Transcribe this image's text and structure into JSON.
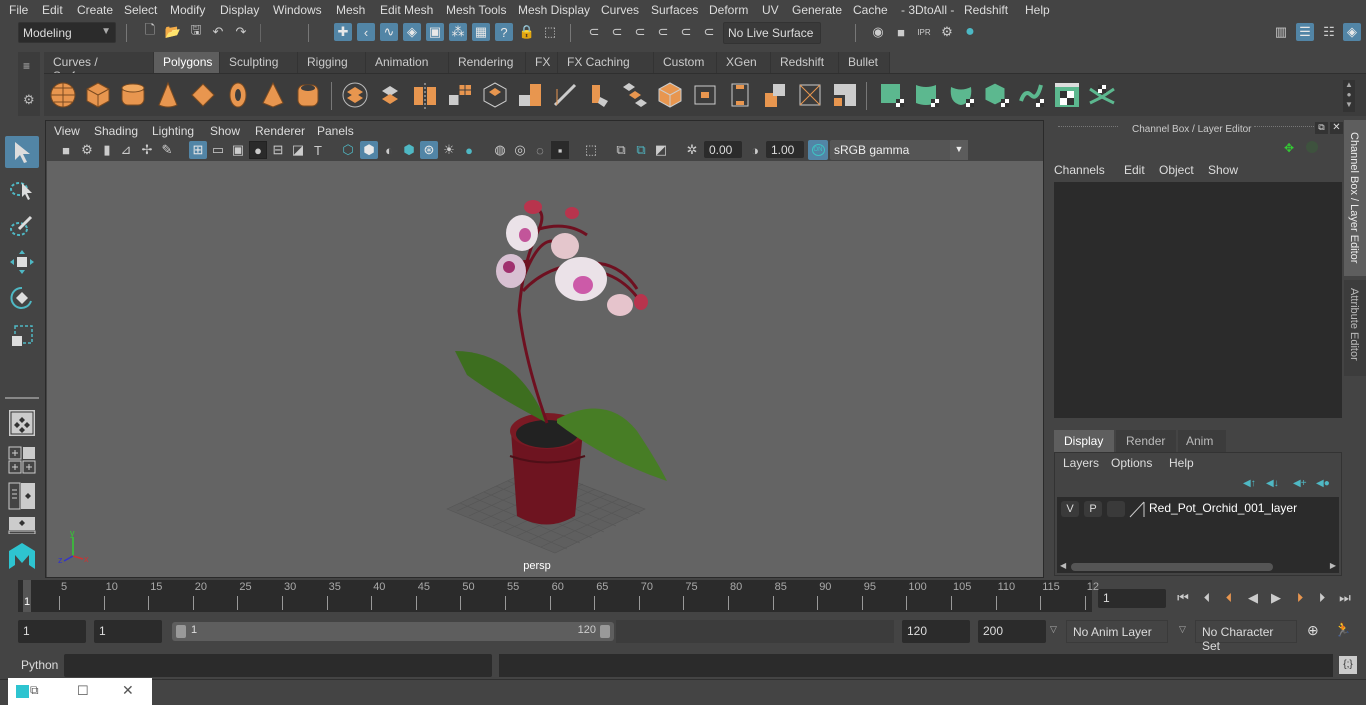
{
  "menubar": {
    "items": [
      "File",
      "Edit",
      "Create",
      "Select",
      "Modify",
      "Display",
      "Windows",
      "Mesh",
      "Edit Mesh",
      "Mesh Tools",
      "Mesh Display",
      "Curves",
      "Surfaces",
      "Deform",
      "UV",
      "Generate",
      "Cache",
      "- 3DtoAll -",
      "Redshift",
      "Help"
    ]
  },
  "statusline": {
    "mode": "Modeling",
    "live_surface": "No Live Surface"
  },
  "shelf": {
    "tabs": [
      "Curves / Surfaces",
      "Polygons",
      "Sculpting",
      "Rigging",
      "Animation",
      "Rendering",
      "FX",
      "FX Caching",
      "Custom",
      "XGen",
      "Redshift",
      "Bullet"
    ],
    "selected_tab": "Polygons"
  },
  "viewport": {
    "menu": [
      "View",
      "Shading",
      "Lighting",
      "Show",
      "Renderer",
      "Panels"
    ],
    "exposure": "0.00",
    "gamma": "1.00",
    "color_mgmt_toggle": "ON",
    "color_space": "sRGB gamma",
    "camera_label": "persp",
    "axis_labels": {
      "x": "x",
      "y": "y",
      "z": "z"
    }
  },
  "channelbox": {
    "title": "Channel Box / Layer Editor",
    "menu": [
      "Channels",
      "Edit",
      "Object",
      "Show"
    ],
    "layer_tabs": [
      "Display",
      "Render",
      "Anim"
    ],
    "selected_layer_tab": "Display",
    "layer_menu": [
      "Layers",
      "Options",
      "Help"
    ],
    "layers": [
      {
        "visible": "V",
        "playback": "P",
        "name": "Red_Pot_Orchid_001_layer"
      }
    ]
  },
  "side_tabs": [
    "Channel Box / Layer Editor",
    "Attribute Editor"
  ],
  "timeline": {
    "ticks": [
      "5",
      "10",
      "15",
      "20",
      "25",
      "30",
      "35",
      "40",
      "45",
      "50",
      "55",
      "60",
      "65",
      "70",
      "75",
      "80",
      "85",
      "90",
      "95",
      "100",
      "105",
      "110",
      "115",
      "12"
    ],
    "start_label": "1",
    "current_frame": "1"
  },
  "range": {
    "start": "1",
    "playback_start": "1",
    "slider_start": "1",
    "slider_end": "120",
    "playback_end": "120",
    "end": "200",
    "anim_layer": "No Anim Layer",
    "character_set": "No Character Set"
  },
  "commandline": {
    "label": "Python"
  }
}
